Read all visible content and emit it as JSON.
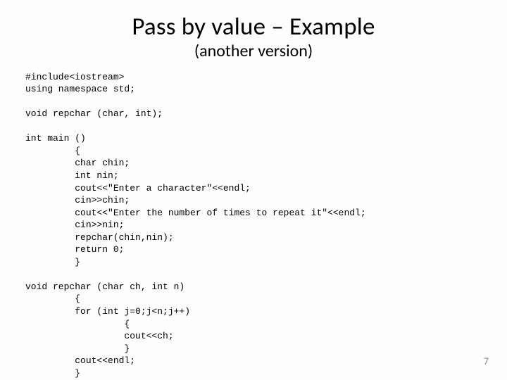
{
  "title": "Pass by value – Example",
  "subtitle": "(another version)",
  "code": "#include<iostream>\nusing namespace std;\n\nvoid repchar (char, int);\n\nint main ()\n         {\n         char chin;\n         int nin;\n         cout<<\"Enter a character\"<<endl;\n         cin>>chin;\n         cout<<\"Enter the number of times to repeat it\"<<endl;\n         cin>>nin;\n         repchar(chin,nin);\n         return 0;\n         }\n\nvoid repchar (char ch, int n)\n         {\n         for (int j=0;j<n;j++)\n                  {\n                  cout<<ch;\n                  }\n         cout<<endl;\n         }",
  "page_number": "7"
}
